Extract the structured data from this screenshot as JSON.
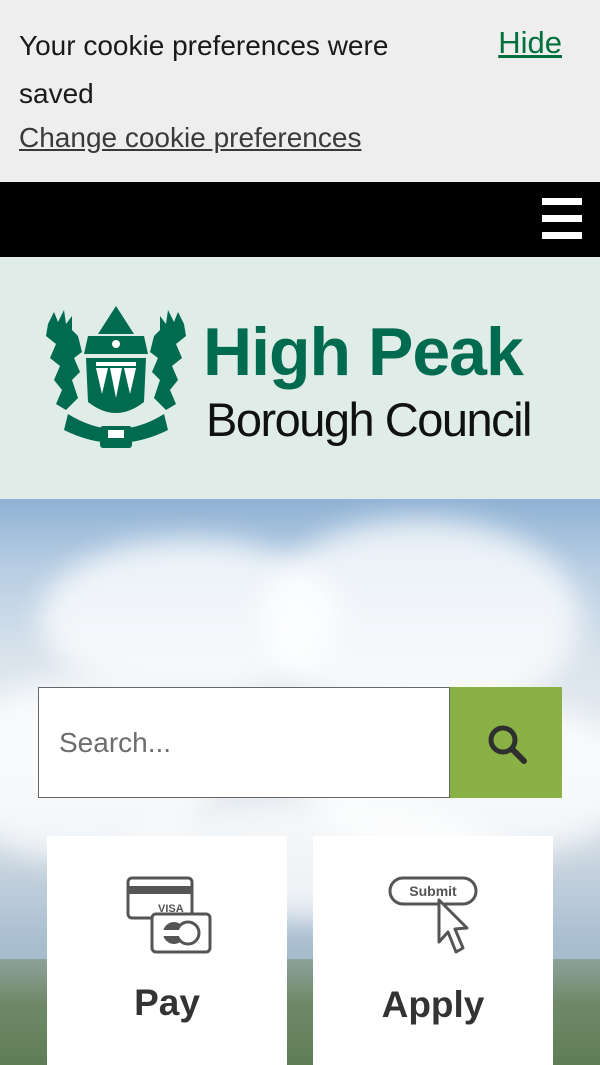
{
  "cookie_banner": {
    "message": "Your cookie preferences were saved",
    "hide_label": "Hide",
    "change_link": "Change cookie preferences"
  },
  "nav": {
    "menu_icon": "hamburger-menu-icon"
  },
  "logo": {
    "line1": "High Peak",
    "line2": "Borough Council",
    "crest_icon": "coat-of-arms-icon",
    "brand_color": "#006b4f"
  },
  "search": {
    "placeholder": "Search...",
    "value": "",
    "button_icon": "search-icon",
    "button_color": "#8ab145"
  },
  "tiles": [
    {
      "label": "Pay",
      "icon": "payment-cards-icon",
      "icon_text": "VISA"
    },
    {
      "label": "Apply",
      "icon": "submit-cursor-icon",
      "icon_text": "Submit"
    }
  ]
}
